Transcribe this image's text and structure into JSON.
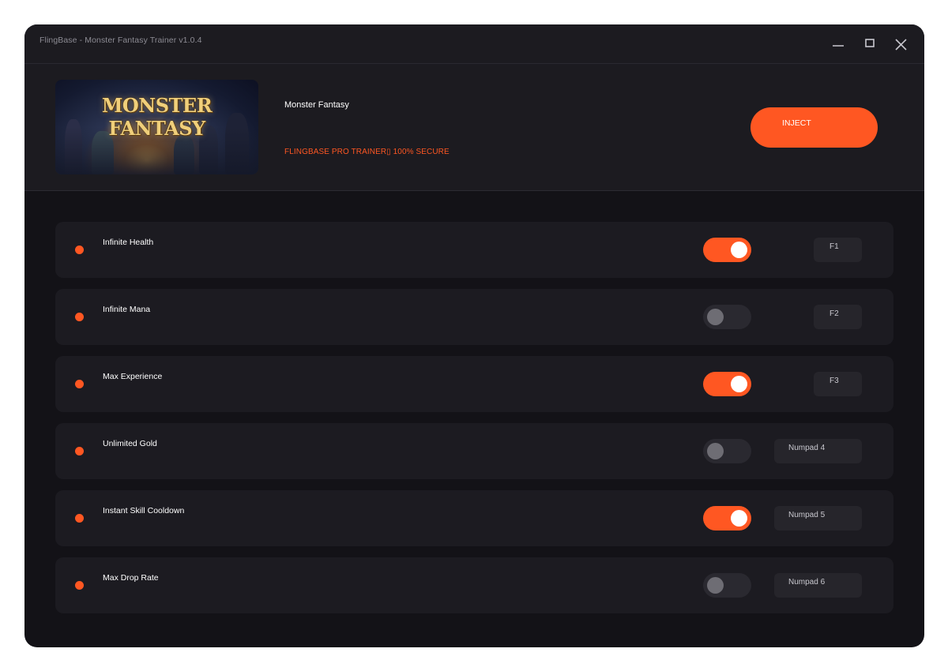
{
  "window": {
    "title": "FlingBase - Monster Fantasy Trainer v1.0.4"
  },
  "header": {
    "banner_logo_text": "MONSTER FANTASY",
    "game_name": "Monster Fantasy",
    "secure_text": "FLINGBASE PRO TRAINER▯ 100% SECURE",
    "inject_label": "INJECT"
  },
  "colors": {
    "accent": "#ff5722",
    "window_bg": "#131217",
    "panel_bg": "#1c1b20",
    "toggle_off": "#2a2930"
  },
  "icons": [
    "minimize-icon",
    "maximize-icon",
    "close-icon"
  ],
  "cheats": [
    {
      "label": "Infinite Health",
      "enabled": true,
      "hotkey": "F1"
    },
    {
      "label": "Infinite Mana",
      "enabled": false,
      "hotkey": "F2"
    },
    {
      "label": "Max Experience",
      "enabled": true,
      "hotkey": "F3"
    },
    {
      "label": "Unlimited Gold",
      "enabled": false,
      "hotkey": "Numpad 4"
    },
    {
      "label": "Instant Skill Cooldown",
      "enabled": true,
      "hotkey": "Numpad 5"
    },
    {
      "label": "Max Drop Rate",
      "enabled": false,
      "hotkey": "Numpad 6"
    }
  ]
}
